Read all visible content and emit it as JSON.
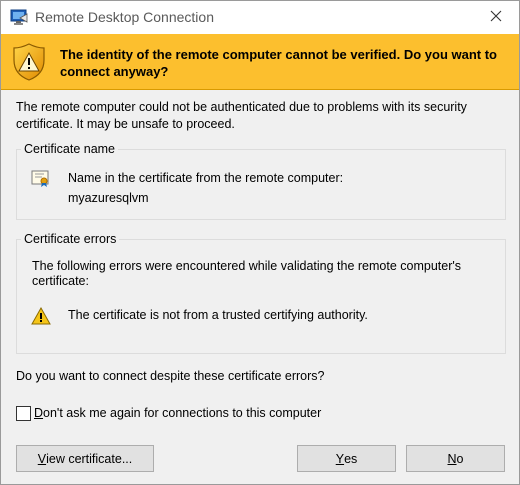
{
  "window": {
    "title": "Remote Desktop Connection",
    "icon": "remote-desktop-icon",
    "close_icon": "close-icon"
  },
  "banner": {
    "icon": "warning-shield-icon",
    "color": "#fcbf2e",
    "text": "The identity of the remote computer cannot be verified. Do you want to connect anyway?"
  },
  "intro": "The remote computer could not be authenticated due to problems with its security certificate. It may be unsafe to proceed.",
  "certificate_name": {
    "legend": "Certificate name",
    "icon": "certificate-icon",
    "description": "Name in the certificate from the remote computer:",
    "value": "myazuresqlvm"
  },
  "certificate_errors": {
    "legend": "Certificate errors",
    "description": "The following errors were encountered while validating the remote computer's certificate:",
    "items": [
      {
        "icon": "warning-triangle-icon",
        "text": "The certificate is not from a trusted certifying authority."
      }
    ]
  },
  "question": "Do you want to connect despite these certificate errors?",
  "dont_ask": {
    "checked": false,
    "label_underlined": "D",
    "label_rest": "on't ask me again for connections to this computer"
  },
  "buttons": {
    "view_certificate": {
      "underlined": "V",
      "rest": "iew certificate..."
    },
    "yes": {
      "underlined": "Y",
      "rest": "es"
    },
    "no": {
      "underlined": "N",
      "rest": "o"
    }
  }
}
